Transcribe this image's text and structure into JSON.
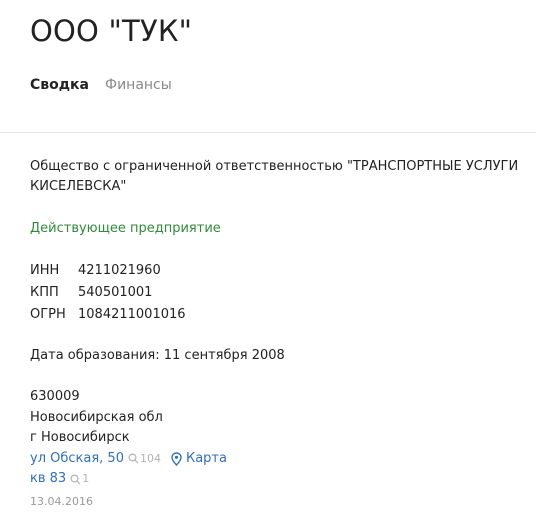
{
  "company": {
    "title": "ООО \"ТУК\"",
    "full_name": "Общество с ограниченной ответственностью \"ТРАНСПОРТНЫЕ УСЛУГИ КИСЕЛЕВСКА\"",
    "status": "Действующее предприятие"
  },
  "tabs": [
    {
      "label": "Сводка",
      "active": true
    },
    {
      "label": "Финансы",
      "active": false
    }
  ],
  "codes": [
    {
      "label": "ИНН",
      "value": "4211021960"
    },
    {
      "label": "КПП",
      "value": "540501001"
    },
    {
      "label": "ОГРН",
      "value": "1084211001016"
    }
  ],
  "founded": "Дата образования: 11 сентября 2008",
  "address": {
    "postcode": "630009",
    "region": "Новосибирская обл",
    "city": "г Новосибирск",
    "street": "ул Обская, 50",
    "street_count": "104",
    "map_label": "Карта",
    "apartment": "кв 83",
    "apartment_count": "1",
    "date": "13.04.2016"
  },
  "icons": {
    "search": "search-icon",
    "map": "map-pin-icon"
  },
  "colors": {
    "status": "#2f8a3a",
    "link": "#2f71b8",
    "muted": "#b3b3b3"
  }
}
